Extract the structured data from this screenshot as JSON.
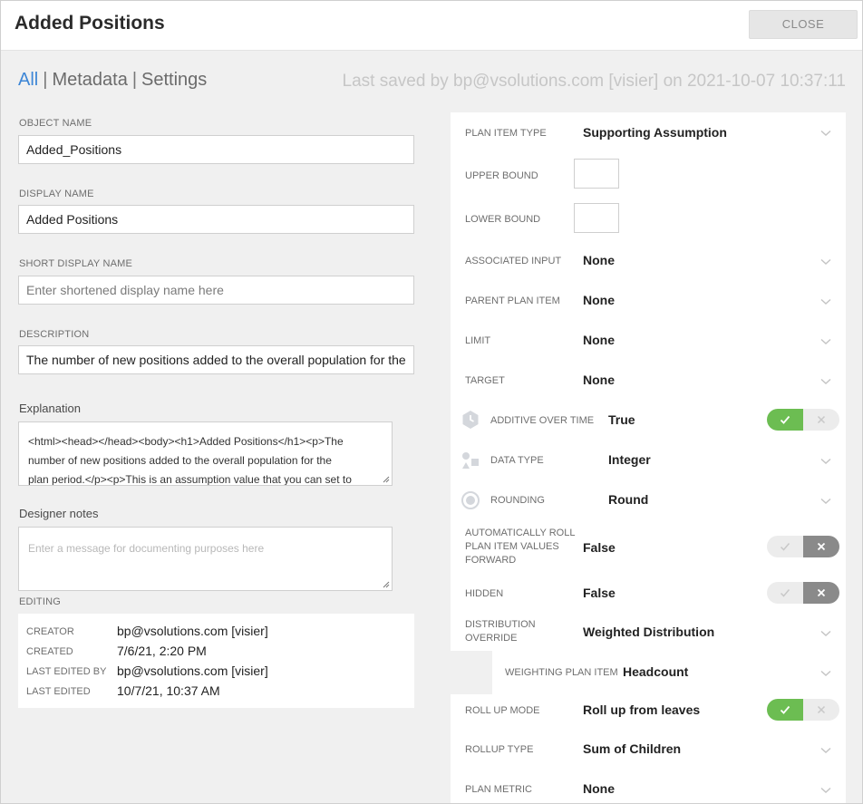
{
  "header": {
    "title": "Added Positions",
    "close_label": "CLOSE"
  },
  "nav": {
    "tabs": [
      "All",
      "Metadata",
      "Settings"
    ],
    "separator": "|",
    "last_saved": "Last saved by bp@vsolutions.com [visier] on 2021-10-07 10:37:11"
  },
  "left": {
    "object_name": {
      "label": "OBJECT NAME",
      "value": "Added_Positions"
    },
    "display_name": {
      "label": "DISPLAY NAME",
      "value": "Added Positions"
    },
    "short_display_name": {
      "label": "SHORT DISPLAY NAME",
      "placeholder": "Enter shortened display name here"
    },
    "description": {
      "label": "DESCRIPTION",
      "value": "The number of new positions added to the overall population for the"
    },
    "explanation": {
      "label": "Explanation",
      "lines": [
        "<html><head></head><body><h1>Added Positions</h1><p>The",
        "number of new positions added to the overall population for the",
        "plan period.</p><p>This is an assumption value that you can set to"
      ]
    },
    "designer_notes": {
      "label": "Designer notes",
      "placeholder": "Enter a message for documenting purposes here"
    },
    "editing": {
      "label": "EDITING",
      "rows": [
        {
          "label": "CREATOR",
          "value": "bp@vsolutions.com [visier]"
        },
        {
          "label": "CREATED",
          "value": "7/6/21, 2:20 PM"
        },
        {
          "label": "LAST EDITED BY",
          "value": "bp@vsolutions.com [visier]"
        },
        {
          "label": "LAST EDITED",
          "value": "10/7/21, 10:37 AM"
        }
      ]
    }
  },
  "right": {
    "plan_item_type": {
      "label": "PLAN ITEM TYPE",
      "value": "Supporting Assumption"
    },
    "upper_bound": {
      "label": "UPPER BOUND"
    },
    "lower_bound": {
      "label": "LOWER BOUND"
    },
    "associated_input": {
      "label": "ASSOCIATED INPUT",
      "value": "None"
    },
    "parent_plan_item": {
      "label": "PARENT PLAN ITEM",
      "value": "None"
    },
    "limit": {
      "label": "LIMIT",
      "value": "None"
    },
    "target": {
      "label": "TARGET",
      "value": "None"
    },
    "additive_over_time": {
      "label": "ADDITIVE OVER TIME",
      "value": "True",
      "on": true
    },
    "data_type": {
      "label": "DATA TYPE",
      "value": "Integer"
    },
    "rounding": {
      "label": "ROUNDING",
      "value": "Round"
    },
    "auto_roll": {
      "label_lines": [
        "AUTOMATICALLY ROLL",
        "PLAN ITEM VALUES",
        "FORWARD"
      ],
      "value": "False",
      "on": false
    },
    "hidden": {
      "label": "HIDDEN",
      "value": "False",
      "on": false
    },
    "distribution_override": {
      "label_lines": [
        "DISTRIBUTION",
        "OVERRIDE"
      ],
      "value": "Weighted Distribution"
    },
    "weighting_plan_item": {
      "label": "WEIGHTING PLAN ITEM",
      "value": "Headcount"
    },
    "roll_up_mode": {
      "label": "ROLL UP MODE",
      "value": "Roll up from leaves",
      "on": true
    },
    "rollup_type": {
      "label": "ROLLUP TYPE",
      "value": "Sum of Children"
    },
    "plan_metric": {
      "label": "PLAN METRIC",
      "value": "None"
    }
  },
  "colors": {
    "accent": "#3d86d6",
    "toggle_on": "#6cbd52",
    "toggle_off": "#8a8a8a",
    "toggle_idle": "#ececec",
    "background": "#f0f0f0"
  }
}
